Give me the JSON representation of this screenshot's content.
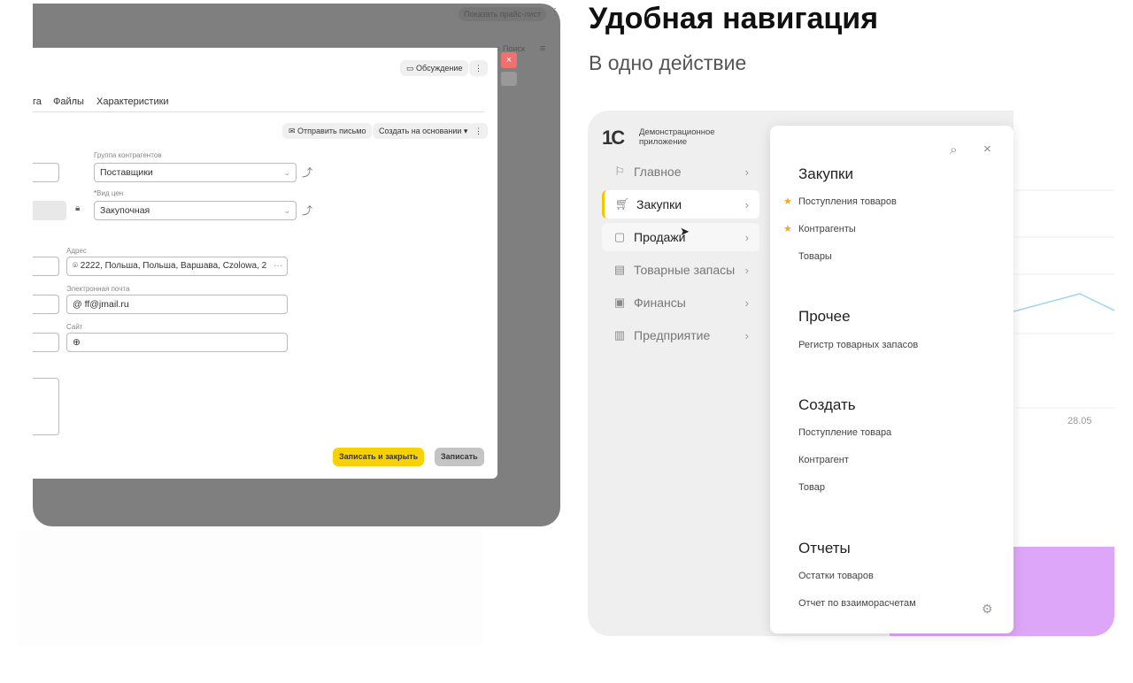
{
  "left_window": {
    "price_list_button": "Показать прайс-лист",
    "search_label": "Поиск",
    "discussion_button": "Обсуждение",
    "tabs": [
      "га",
      "Файлы",
      "Характеристики"
    ],
    "send_letter_button": "Отправить письмо",
    "create_based_button": "Создать на основании",
    "group_label": "Группа контрагентов",
    "group_value": "Поставщики",
    "price_type_label": "Вид цен",
    "price_type_value": "Закупочная",
    "address_label": "Адрес",
    "address_value": "2222, Польша, Польша, Варшава, Czolowa, 2",
    "email_label": "Электронная почта",
    "email_value": "ff@jmail.ru",
    "site_label": "Сайт",
    "site_value": "",
    "save_close_button": "Записать и закрыть",
    "save_button": "Записать"
  },
  "heading": {
    "title": "Удобная навигация",
    "subtitle": "В одно действие"
  },
  "app": {
    "logo": "1С",
    "app_name": "Демонстрационное приложение",
    "nav": [
      "Главное",
      "Закупки",
      "Продажи",
      "Товарные запасы",
      "Финансы",
      "Предприятие"
    ],
    "chart_tick": "28.05",
    "menu": {
      "sections": [
        {
          "title": "Закупки",
          "items": [
            "Поступления товаров",
            "Контрагенты",
            "Товары"
          ]
        },
        {
          "title": "Прочее",
          "items": [
            "Регистр товарных запасов"
          ]
        },
        {
          "title": "Создать",
          "items": [
            "Поступление товара",
            "Контрагент",
            "Товар"
          ]
        },
        {
          "title": "Отчеты",
          "items": [
            "Остатки товаров",
            "Отчет по взаиморасчетам"
          ]
        }
      ]
    }
  },
  "colors": {
    "accent_yellow": "#f5d000",
    "star": "#f5a623",
    "purple": "#dea6f8",
    "close_red": "#f07070"
  }
}
